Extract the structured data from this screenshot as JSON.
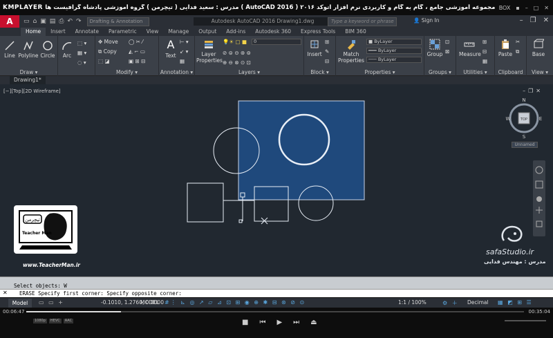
{
  "player": {
    "logo": "KMPLAYER",
    "title": "مجموعه آموزشی جامع ، گام به گام و کاربردی نرم افزار اتوکد ۲۰۱۶ ( AutoCAD 2016 ) مدرس : سعید فدایی ( تیچرمن ) گروه آموزشی پادشاه گرافیست ها",
    "box_label": "BOX",
    "elapsed": "00:06:47",
    "total": "00:35:04",
    "progress_fraction": 0.19,
    "tags": [
      "1080p",
      "HEVC",
      "AAC"
    ]
  },
  "autocad": {
    "logo": "A",
    "workspace": "Drafting & Annotation",
    "app_title": "Autodesk AutoCAD 2016   Drawing1.dwg",
    "search_placeholder": "Type a keyword or phrase",
    "signin": "Sign In"
  },
  "ribbon_tabs": [
    "Home",
    "Insert",
    "Annotate",
    "Parametric",
    "View",
    "Manage",
    "Output",
    "Add-ins",
    "Autodesk 360",
    "Express Tools",
    "BIM 360"
  ],
  "ribbon": {
    "draw": {
      "label": "Draw",
      "line": "Line",
      "polyline": "Polyline",
      "circle": "Circle",
      "arc": "Arc"
    },
    "modify": {
      "label": "Modify",
      "move": "Move",
      "copy": "Copy"
    },
    "annotation": {
      "label": "Annotation",
      "text": "Text"
    },
    "layers": {
      "label": "Layers",
      "layer_properties": "Layer\nProperties",
      "layer_value": "0"
    },
    "block": {
      "label": "Block",
      "insert": "Insert"
    },
    "properties": {
      "label": "Properties",
      "match": "Match\nProperties",
      "bylayer1": "ByLayer",
      "bylayer2": "ByLayer",
      "bylayer3": "ByLayer"
    },
    "groups": {
      "label": "Groups",
      "group": "Group"
    },
    "utilities": {
      "label": "Utilities",
      "measure": "Measure"
    },
    "clipboard": {
      "label": "Clipboard",
      "paste": "Paste"
    },
    "view": {
      "label": "View",
      "base": "Base"
    }
  },
  "doc_tab": "Drawing1*",
  "viewport": {
    "label": "[−][Top][2D Wireframe]",
    "viewcube_face": "TOP",
    "compass": {
      "n": "N",
      "s": "S",
      "e": "E",
      "w": "W"
    },
    "named_view": "Unnamed"
  },
  "watermarks": {
    "logo_caption": "www.TeacherMan.ir",
    "logo_name": "Teacher Man",
    "logo_title": "تیچرمن",
    "site": "safaStudio.ir",
    "teacher": "مدرس : مهندس فدایی"
  },
  "command": {
    "history": "Select objects: W",
    "current": "ERASE Specify first corner: Specify opposite corner:"
  },
  "status": {
    "model_tab": "Model",
    "coords": "-0.1010, 1.2760, 0.0000",
    "model_btn": "MODEL",
    "scale": "1:1 / 100%",
    "units": "Decimal"
  }
}
